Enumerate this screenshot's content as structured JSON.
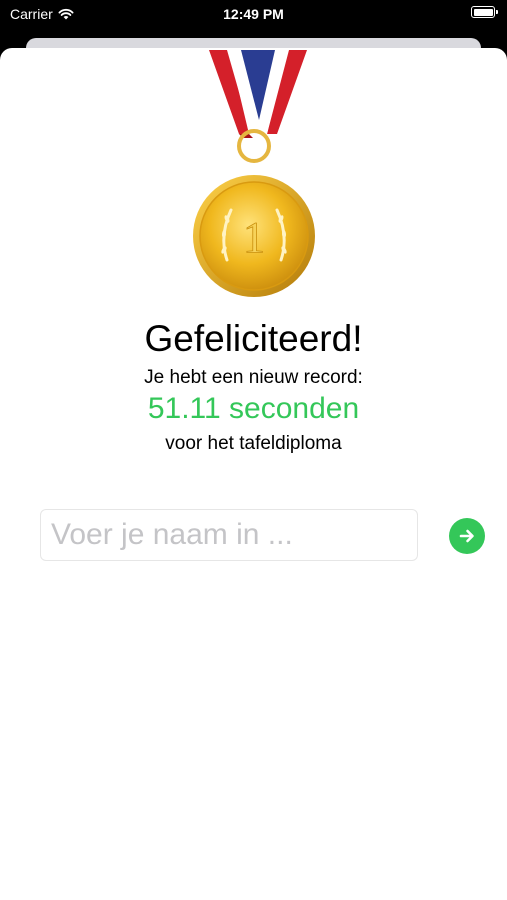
{
  "status_bar": {
    "carrier": "Carrier",
    "time": "12:49 PM",
    "wifi_icon": "wifi-icon",
    "battery_icon": "battery-icon"
  },
  "medal": {
    "icon": "gold-medal-icon",
    "number": "1",
    "ribbon_colors": [
      "#d4202a",
      "#ffffff",
      "#2a3d92"
    ],
    "gold_color": "#e8b21a"
  },
  "content": {
    "title": "Gefeliciteerd!",
    "subtitle": "Je hebt een nieuw record:",
    "record": "51.11 seconden",
    "context": "voor het tafeldiploma"
  },
  "name_input": {
    "placeholder": "Voer je naam in ...",
    "value": ""
  },
  "submit_button": {
    "icon": "arrow-right-icon",
    "color": "#34c759"
  }
}
